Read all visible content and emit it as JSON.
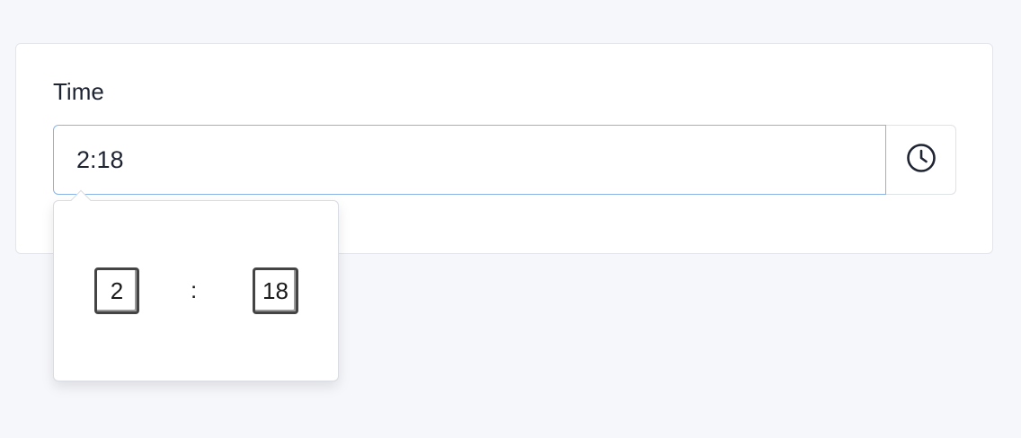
{
  "field": {
    "label": "Time",
    "value": "2:18",
    "clock_icon": "clock-icon"
  },
  "picker": {
    "hours": "2",
    "separator": ":",
    "minutes": "18"
  },
  "colors": {
    "page_bg": "#f6f7fb",
    "focus_border": "#8ab4e8",
    "text": "#1f2433"
  }
}
